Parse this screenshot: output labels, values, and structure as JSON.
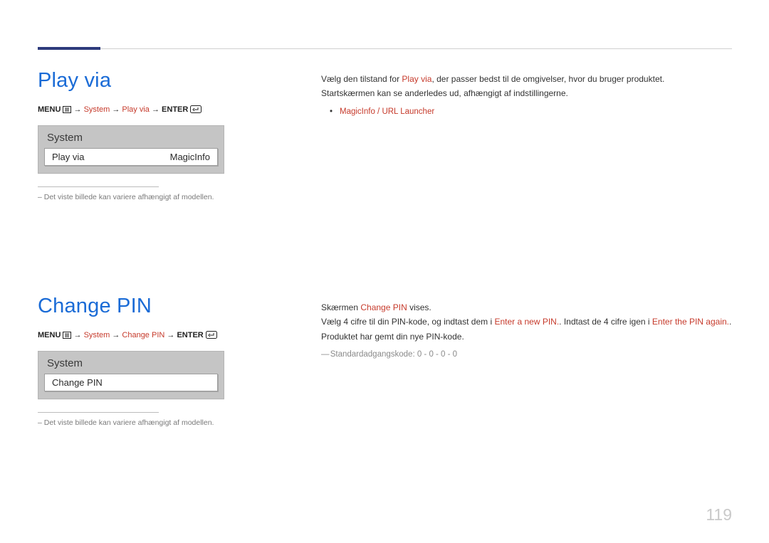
{
  "page_number": "119",
  "nav_tokens": {
    "menu": "MENU",
    "arrow": "→",
    "enter": "ENTER"
  },
  "section1": {
    "title": "Play via",
    "path": {
      "system": "System",
      "item": "Play via"
    },
    "osd": {
      "header": "System",
      "row_label": "Play via",
      "row_value": "MagicInfo"
    },
    "note": "– Det viste billede kan variere afhængigt af modellen.",
    "body": {
      "p1_a": "Vælg den tilstand for ",
      "p1_hl": "Play via",
      "p1_b": ", der passer bedst til de omgivelser, hvor du bruger produktet.",
      "p2": "Startskærmen kan se anderledes ud, afhængigt af indstillingerne.",
      "bullet1": "MagicInfo / URL Launcher"
    }
  },
  "section2": {
    "title": "Change PIN",
    "path": {
      "system": "System",
      "item": "Change PIN"
    },
    "osd": {
      "header": "System",
      "row_label": "Change PIN"
    },
    "note": "– Det viste billede kan variere afhængigt af modellen.",
    "body": {
      "p1_a": "Skærmen ",
      "p1_hl": "Change PIN",
      "p1_b": " vises.",
      "p2_a": "Vælg 4 cifre til din PIN-kode, og indtast dem i ",
      "p2_hl1": "Enter a new PIN.",
      "p2_b": ". Indtast de 4 cifre igen i ",
      "p2_hl2": "Enter the PIN again.",
      "p2_c": ".",
      "p3": "Produktet har gemt din nye PIN-kode.",
      "subnote": "Standardadgangskode: 0 - 0 - 0 - 0"
    }
  }
}
